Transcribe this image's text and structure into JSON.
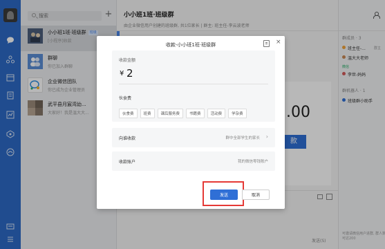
{
  "search": {
    "placeholder": "搜索"
  },
  "conversations": [
    {
      "title": "小小班1班·班级群",
      "tag": "班级",
      "subtitle": "[小程序]收款"
    },
    {
      "title": "群聊",
      "subtitle": "你已加入群聊"
    },
    {
      "title": "企业微信团队",
      "subtitle": "你已成为企业管理员"
    },
    {
      "title": "武平县月宸湾幼...",
      "subtitle": "大家好！我是温大大..."
    }
  ],
  "chat": {
    "title": "小小班1班·班级群",
    "subtitle": "由企业微信用户创建的班级群, 共1位家长  | 群主: 班主任-李云波老师",
    "bg_amount": ".00",
    "bg_button": "款",
    "send_hint": "发送(S)"
  },
  "right_panel": {
    "members_label": "群成员 · 3",
    "members": [
      {
        "name": "班主任-...",
        "role": "群主"
      },
      {
        "name": "温大大老师"
      }
    ],
    "wechat_label": "微信",
    "wechat_member": "李世-妈妈",
    "robots_label": "群机器人 · 1",
    "robot_name": "班级群小助手",
    "footer": "可邀请微信用户进群, 群人数可达200"
  },
  "modal": {
    "title": "收款-小小班1班·班级群",
    "amount_label": "收款金额",
    "currency": "¥",
    "amount": "2",
    "fee_label": "伙食费",
    "chips": [
      "伙食费",
      "班费",
      "课后服务费",
      "书籍费",
      "活动费",
      "学杂费"
    ],
    "target_label": "向谁收款",
    "target_value": "群中全部学生的家长",
    "account_label": "收款账户",
    "account_value": "我的微信零钱账户",
    "send_label": "发送",
    "cancel_label": "取消"
  },
  "colors": {
    "nav": "#2d6ac7",
    "primary": "#2f6fd6",
    "highlight": "#e53935"
  }
}
